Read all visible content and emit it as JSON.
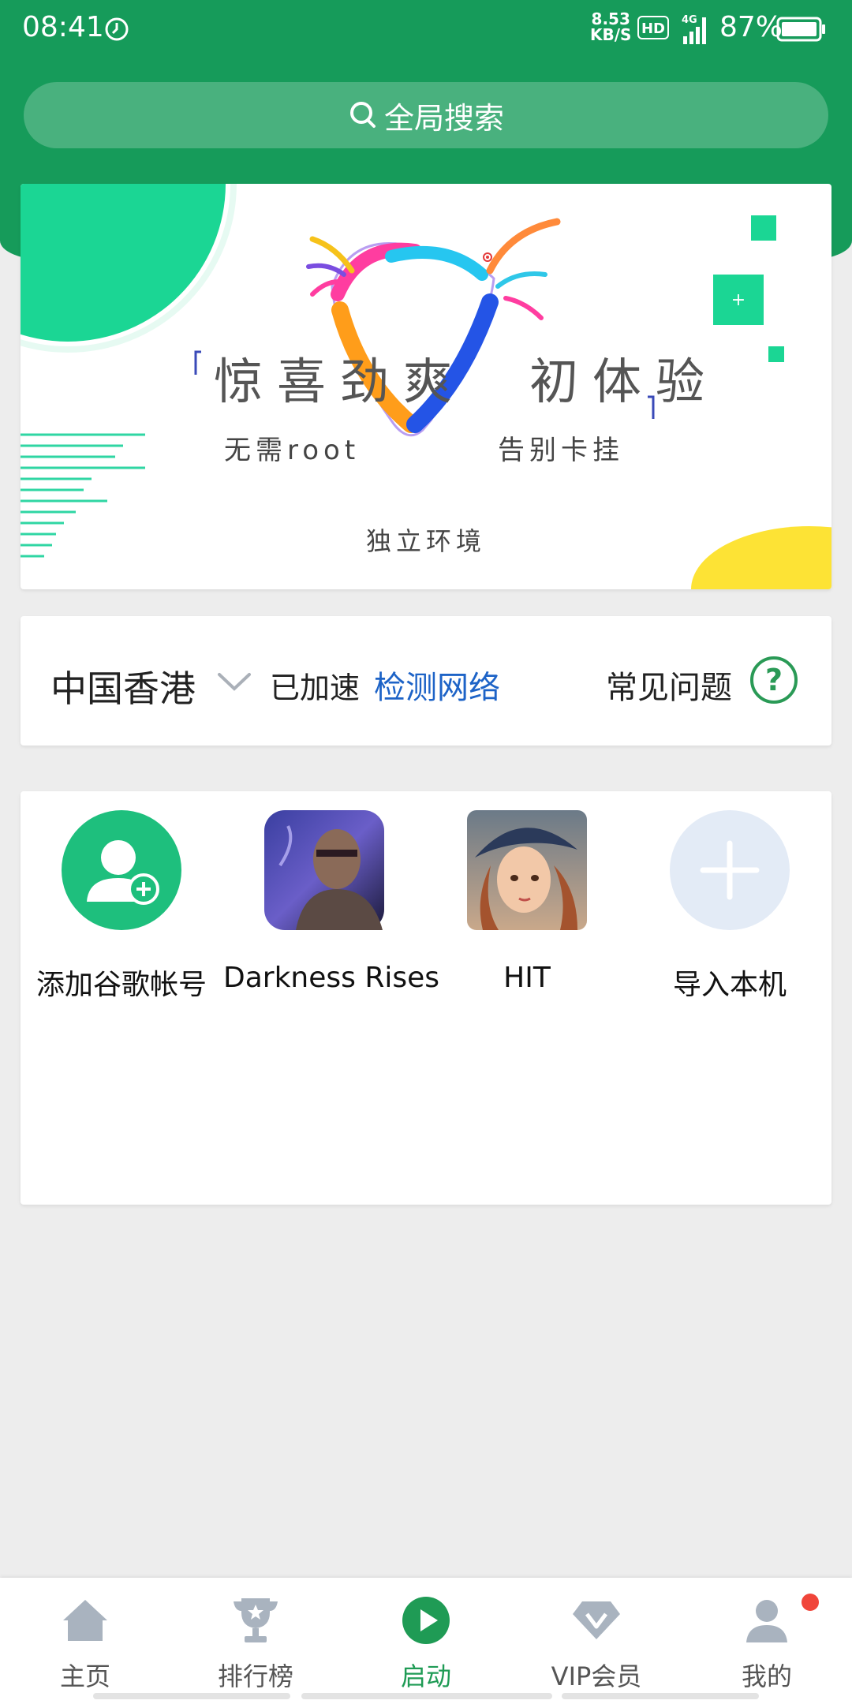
{
  "status_bar": {
    "time": "08:41",
    "net_speed_value": "8.53",
    "net_speed_unit": "KB/S",
    "hd_label": "HD",
    "network_type": "4G",
    "battery": "87%"
  },
  "search": {
    "label": "全局搜索"
  },
  "banner": {
    "headline": "惊喜劲爽　初体验",
    "left_text": "无需root",
    "right_text": "告别卡挂",
    "center_text": "独立环境"
  },
  "region": {
    "name": "中国香港",
    "status": "已加速",
    "detect_link": "检测网络",
    "faq_link": "常见问题"
  },
  "apps": [
    {
      "label": "添加谷歌帐号",
      "icon": "add-account-icon"
    },
    {
      "label": "Darkness Rises",
      "icon": "darkness-rises-app-icon"
    },
    {
      "label": "HIT",
      "icon": "hit-app-icon"
    },
    {
      "label": "导入本机",
      "icon": "plus-icon"
    }
  ],
  "nav": [
    {
      "label": "主页",
      "icon": "home-icon"
    },
    {
      "label": "排行榜",
      "icon": "trophy-icon"
    },
    {
      "label": "启动",
      "icon": "play-icon",
      "active": true
    },
    {
      "label": "VIP会员",
      "icon": "vip-diamond-icon"
    },
    {
      "label": "我的",
      "icon": "profile-icon",
      "badge": true
    }
  ],
  "colors": {
    "brand_green": "#169b5a",
    "link_blue": "#1d63c7",
    "active_nav": "#1f9b55",
    "badge_red": "#f0453a"
  }
}
